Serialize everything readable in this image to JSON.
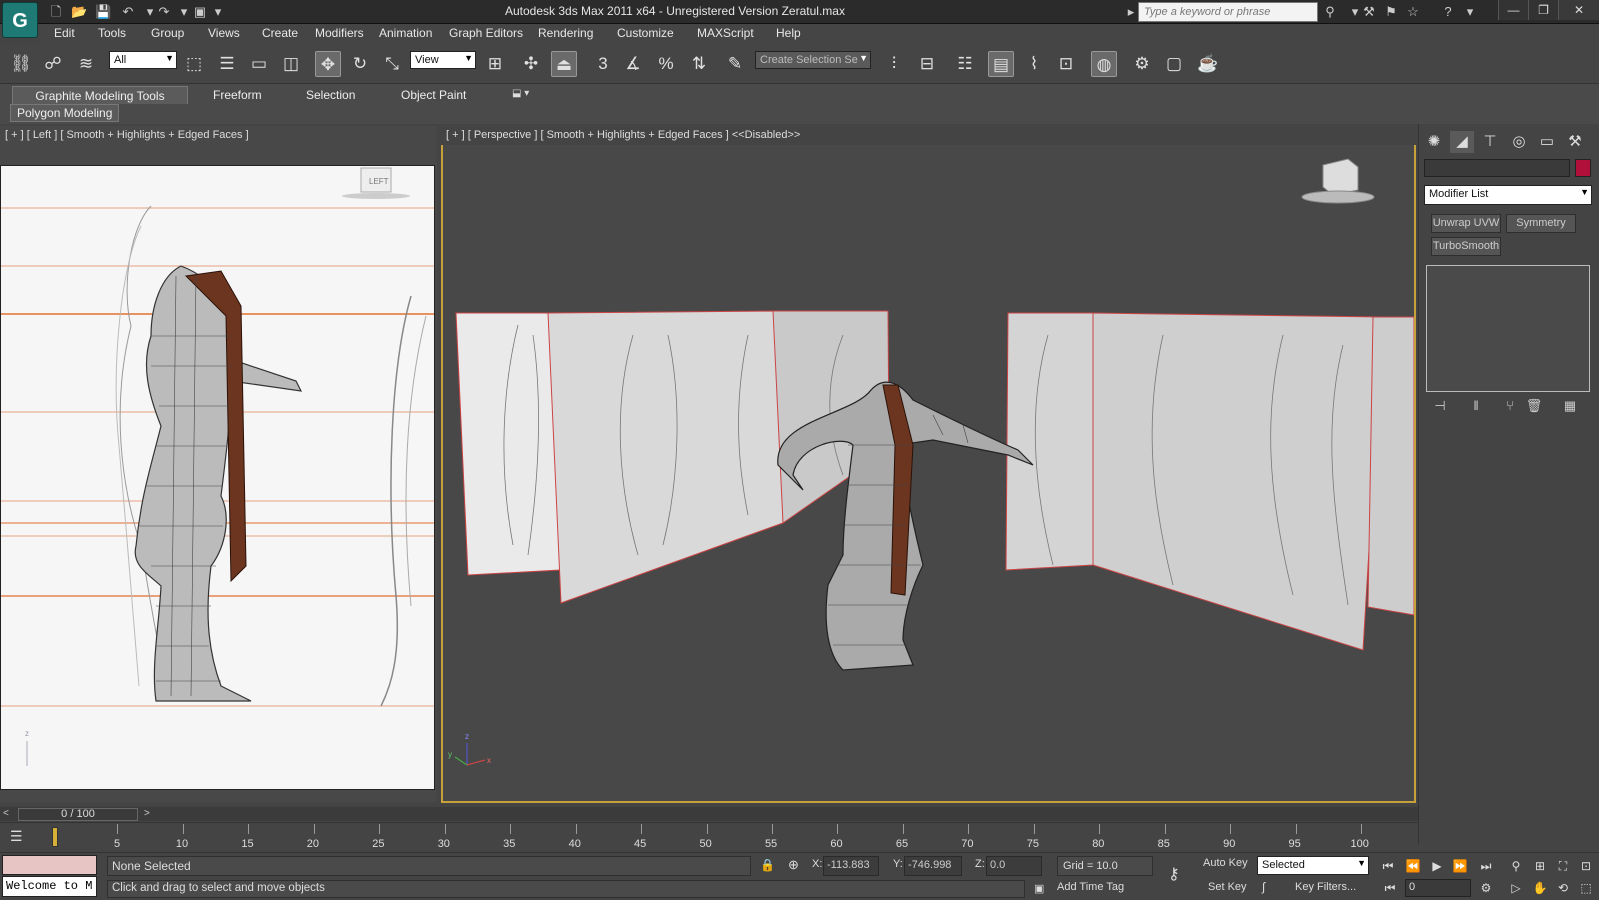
{
  "window": {
    "title": "Autodesk 3ds Max  2011 x64  -  Unregistered Version    Zeratul.max",
    "search_placeholder": "Type a keyword or phrase",
    "minimize": "—",
    "maximize": "❐",
    "close": "✕"
  },
  "menu": {
    "items": [
      "Edit",
      "Tools",
      "Group",
      "Views",
      "Create",
      "Modifiers",
      "Animation",
      "Graph Editors",
      "Rendering",
      "Customize",
      "MAXScript",
      "Help"
    ]
  },
  "toolbar": {
    "selection_filter": "All",
    "reference_coord": "View",
    "named_selection_placeholder": "Create Selection Se",
    "snap_label": "3"
  },
  "ribbon": {
    "tabs": [
      "Graphite Modeling Tools",
      "Freeform",
      "Selection",
      "Object Paint"
    ],
    "active_panel": "Polygon Modeling"
  },
  "viewports": {
    "left_label": "[ + ] [ Left ] [ Smooth + Highlights + Edged Faces ]",
    "left_viewcube": "LEFT",
    "persp_label": "[ + ] [ Perspective ] [ Smooth + Highlights + Edged Faces ] <<Disabled>>",
    "axis_z": "z",
    "axis_x": "x",
    "axis_y": "y"
  },
  "command_panel": {
    "modifier_list": "Modifier List",
    "modifier_buttons": [
      "Unwrap UVW",
      "Symmetry",
      "TurboSmooth"
    ],
    "color": "#b0103a"
  },
  "timeline": {
    "slider_label": "0 / 100",
    "ticks": [
      "5",
      "10",
      "15",
      "20",
      "25",
      "30",
      "35",
      "40",
      "45",
      "50",
      "55",
      "60",
      "65",
      "70",
      "75",
      "80",
      "85",
      "90",
      "95",
      "100"
    ]
  },
  "status": {
    "maxscript_text": "Welcome to M",
    "selection_status": "None Selected",
    "prompt": "Click and drag to select and move objects",
    "x_label": "X:",
    "x_value": "-113.883",
    "y_label": "Y:",
    "y_value": "-746.998",
    "z_label": "Z:",
    "z_value": "0.0",
    "grid": "Grid = 10.0",
    "add_time_tag": "Add Time Tag",
    "auto_key": "Auto Key",
    "set_key": "Set Key",
    "key_filters": "Key Filters...",
    "selected": "Selected",
    "frame": "0"
  }
}
